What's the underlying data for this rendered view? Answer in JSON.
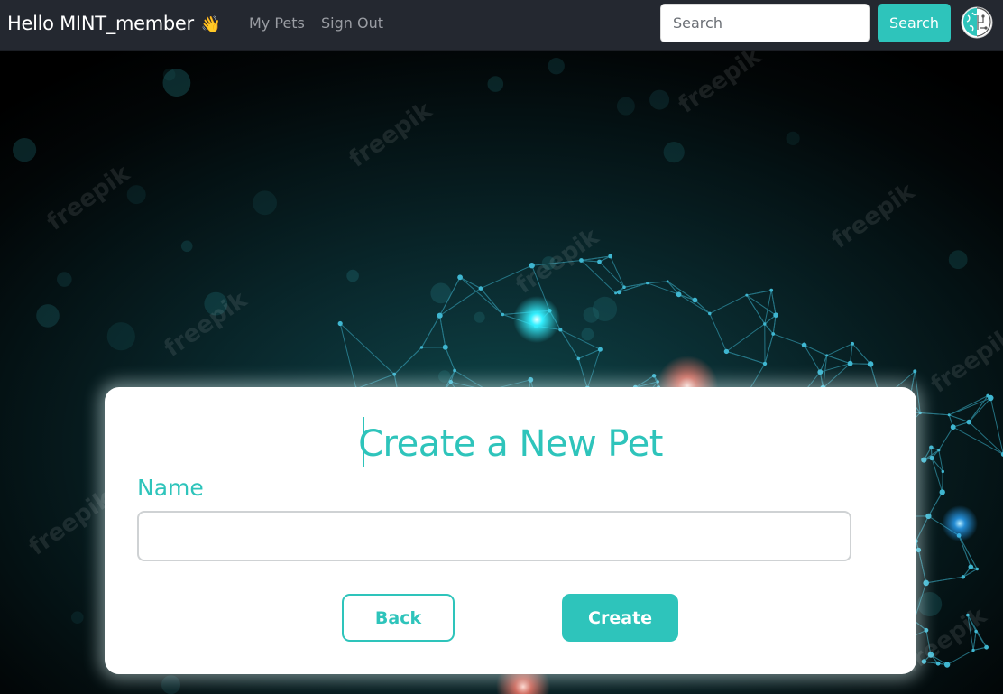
{
  "navbar": {
    "greeting": "Hello MINT_member",
    "wave_emoji": "👋",
    "links": [
      {
        "label": "My Pets"
      },
      {
        "label": "Sign Out"
      }
    ],
    "search": {
      "placeholder": "Search",
      "value": "",
      "button_label": "Search"
    },
    "logo_icon": "brain-logo-icon"
  },
  "background": {
    "watermark": "freepik"
  },
  "form": {
    "title": "Create a New Pet",
    "name_label": "Name",
    "name_value": "",
    "back_label": "Back",
    "create_label": "Create"
  },
  "colors": {
    "accent": "#2ec4bb",
    "navbar": "#242830",
    "card": "#ffffff"
  }
}
